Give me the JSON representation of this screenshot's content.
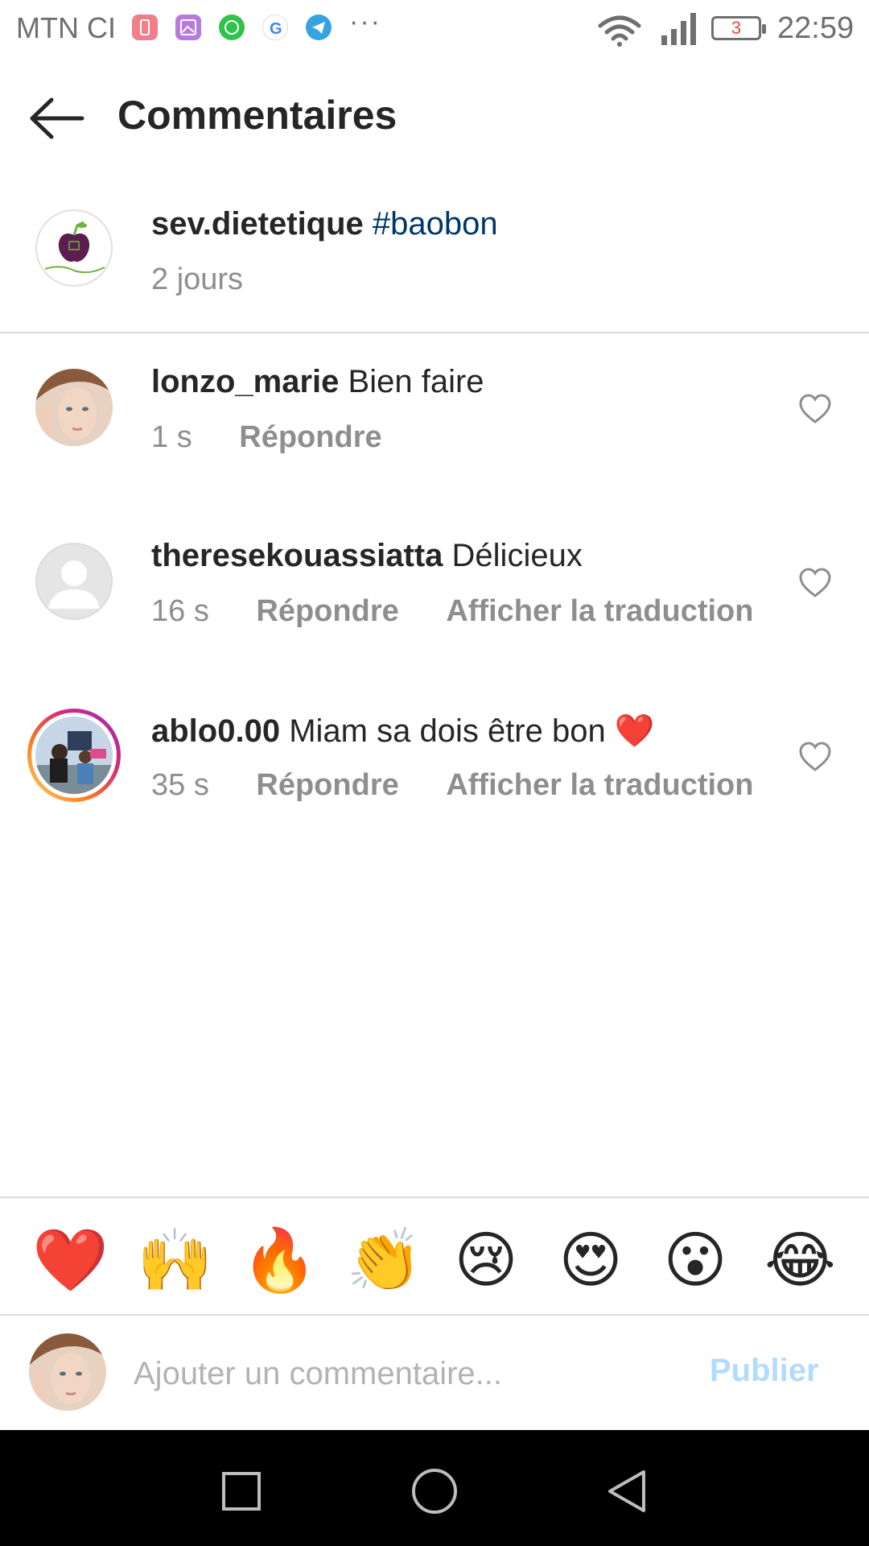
{
  "status_bar": {
    "carrier": "MTN CI",
    "more": "···",
    "battery_level": "3",
    "time": "22:59",
    "app_icons": [
      "battery-saver-icon",
      "gallery-icon",
      "whatsapp-icon",
      "google-icon",
      "telegram-icon"
    ]
  },
  "header": {
    "title": "Commentaires"
  },
  "caption": {
    "username": "sev.dietetique",
    "hashtag": "#baobon",
    "time": "2 jours"
  },
  "comments": [
    {
      "username": "lonzo_marie",
      "text": "Bien faire",
      "time": "1 s",
      "reply": "Répondre"
    },
    {
      "username": "theresekouassiatta",
      "text": "Délicieux",
      "time": "16 s",
      "reply": "Répondre",
      "translate": "Afficher la traduction"
    },
    {
      "username": "ablo0.00",
      "text": "Miam sa dois être bon ❤️",
      "time": "35 s",
      "reply": "Répondre",
      "translate": "Afficher la traduction"
    }
  ],
  "reactions": [
    "❤️",
    "🙌",
    "🔥",
    "👏",
    "😢",
    "😍",
    "😮",
    "😂"
  ],
  "composer": {
    "placeholder": "Ajouter un commentaire...",
    "publish": "Publier"
  },
  "colors": {
    "hashtag": "#00376b",
    "publish_disabled": "#b3dbff",
    "secondary_text": "#8e8e8e",
    "divider": "#dbdbdb"
  }
}
